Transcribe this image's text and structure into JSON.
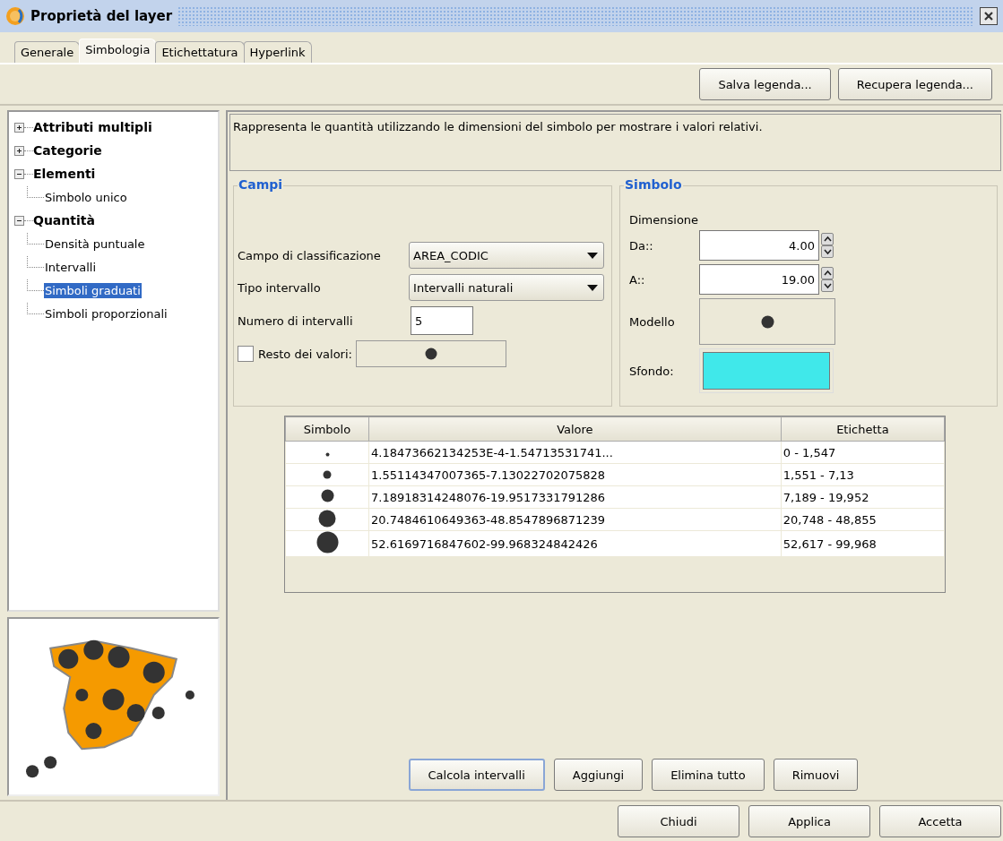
{
  "window": {
    "title": "Proprietà del layer"
  },
  "tabs": [
    {
      "label": "Generale",
      "selected": false
    },
    {
      "label": "Simbologia",
      "selected": true
    },
    {
      "label": "Etichettatura",
      "selected": false
    },
    {
      "label": "Hyperlink",
      "selected": false
    }
  ],
  "toolbar_buttons": [
    "Salva legenda...",
    "Recupera legenda..."
  ],
  "tree": [
    {
      "label": "Attributi multipli",
      "expanded": false
    },
    {
      "label": "Categorie",
      "expanded": false
    },
    {
      "label": "Elementi",
      "expanded": true,
      "children": [
        {
          "label": "Simbolo unico",
          "selected": false
        }
      ]
    },
    {
      "label": "Quantità",
      "expanded": true,
      "children": [
        {
          "label": "Densità puntuale",
          "selected": false
        },
        {
          "label": "Intervalli",
          "selected": false
        },
        {
          "label": "Simboli graduati",
          "selected": true
        },
        {
          "label": "Simboli proporzionali",
          "selected": false
        }
      ]
    }
  ],
  "preview": {
    "kind": "picture"
  },
  "description": "Rappresenta le quantità utilizzando le dimensioni del simbolo per mostrare i valori relativi.",
  "campi": {
    "title": "Campi",
    "classification_label": "Campo di classificazione",
    "classification_value": "AREA_CODIC",
    "interval_type_label": "Tipo intervallo",
    "interval_type_value": "Intervalli naturali",
    "interval_count_label": "Numero di intervalli",
    "interval_count_value": "5",
    "rest_label": "Resto dei valori:",
    "rest_checked": false
  },
  "simbolo": {
    "title": "Simbolo",
    "dimension_label": "Dimensione",
    "from_label": "Da::",
    "from_value": "4.00",
    "to_label": "A::",
    "to_value": "19.00",
    "model_label": "Modello",
    "background_label": "Sfondo:",
    "background_swatch": {
      "color": "#40e8ea"
    }
  },
  "table": {
    "columns": [
      "Simbolo",
      "Valore",
      "Etichetta"
    ],
    "rows": [
      {
        "value": "4.18473662134253E-4-1.54713531741...",
        "label": "0 - 1,547"
      },
      {
        "value": "1.55114347007365-7.13022702075828",
        "label": "1,551 - 7,13"
      },
      {
        "value": "7.18918314248076-19.9517331791286",
        "label": "7,189 - 19,952"
      },
      {
        "value": "20.7484610649363-48.8547896871239",
        "label": "20,748 - 48,855"
      },
      {
        "value": "52.6169716847602-99.968324842426",
        "label": "52,617 - 99,968"
      }
    ]
  },
  "action_buttons": [
    {
      "label": "Calcola intervalli",
      "focused": true
    },
    {
      "label": "Aggiungi",
      "focused": false
    },
    {
      "label": "Elimina tutto",
      "focused": false
    },
    {
      "label": "Rimuovi",
      "focused": false
    }
  ],
  "dialog_buttons": [
    "Chiudi",
    "Applica",
    "Accetta"
  ]
}
